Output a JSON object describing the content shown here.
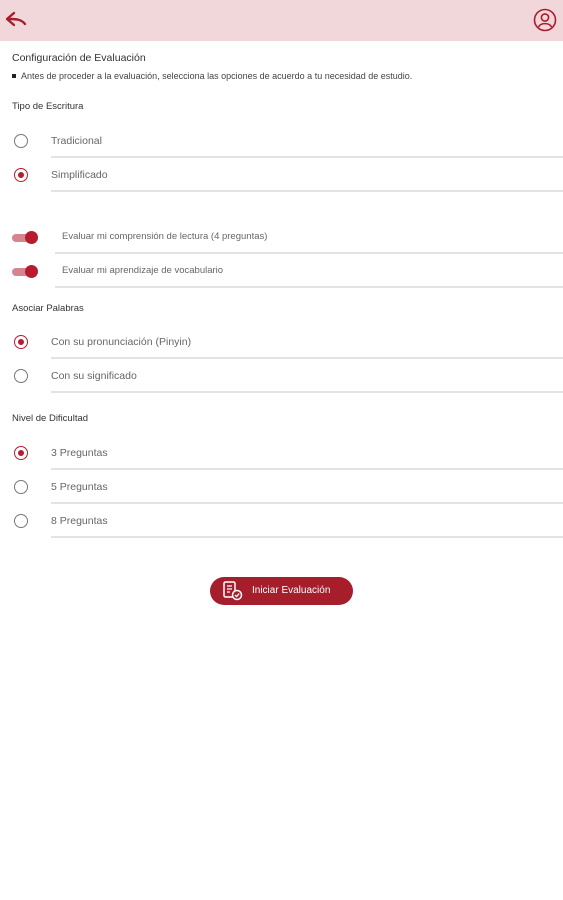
{
  "header": {
    "back_icon": "back-arrow-icon",
    "profile_icon": "user-circle-icon",
    "background": "#f2d7da",
    "accent": "#a61d2c"
  },
  "intro": {
    "title": "Configuración de Evaluación",
    "note": "Antes de proceder a la evaluación, selecciona las opciones de acuerdo a tu necesidad de estudio."
  },
  "writing_type": {
    "title": "Tipo de Escritura",
    "options": [
      {
        "label": "Tradicional",
        "selected": false
      },
      {
        "label": "Simplificado",
        "selected": true
      }
    ]
  },
  "toggles": [
    {
      "label": "Evaluar mi comprensión de lectura (4 preguntas)",
      "on": true
    },
    {
      "label": "Evaluar mi aprendizaje de vocabulario",
      "on": true
    }
  ],
  "associate_words": {
    "title": "Asociar Palabras",
    "options": [
      {
        "label": "Con su pronunciación (Pinyin)",
        "selected": true
      },
      {
        "label": "Con su significado",
        "selected": false
      }
    ]
  },
  "difficulty": {
    "title": "Nivel de Dificultad",
    "options": [
      {
        "label": "3 Preguntas",
        "selected": true
      },
      {
        "label": "5 Preguntas",
        "selected": false
      },
      {
        "label": "8 Preguntas",
        "selected": false
      }
    ]
  },
  "start_button": {
    "label": "Iniciar Evaluación",
    "icon": "exam-document-icon"
  }
}
